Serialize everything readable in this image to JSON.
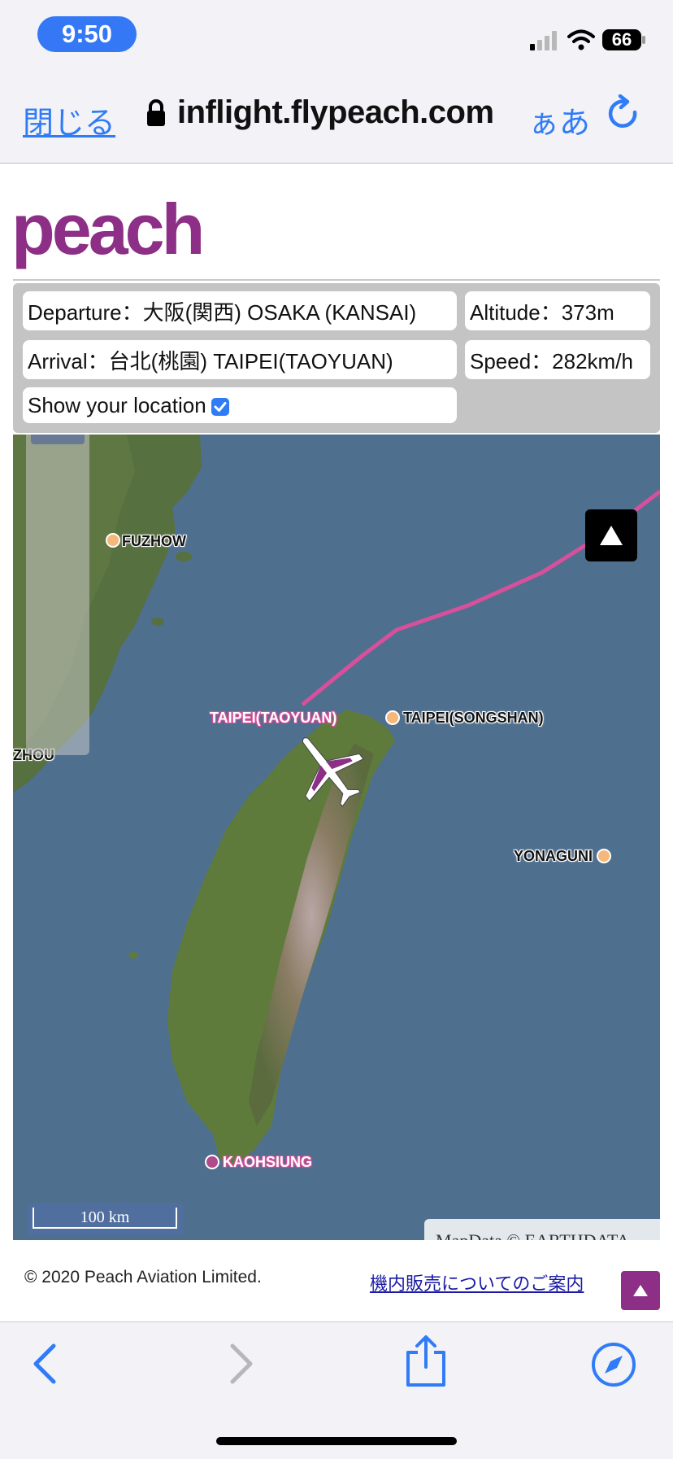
{
  "status_bar": {
    "time": "9:50",
    "battery": "66"
  },
  "address_bar": {
    "close_label": "閉じる",
    "url": "inflight.flypeach.com",
    "text_size_label": "ぁあ"
  },
  "logo_text": "peach",
  "flight_info": {
    "departure": "Departure：大阪(関西) OSAKA (KANSAI)",
    "arrival": "Arrival：台北(桃園) TAIPEI(TAOYUAN)",
    "altitude": "Altitude：373m",
    "speed": "Speed：282km/h",
    "show_location_label": "Show your location",
    "show_location_checked": true
  },
  "map": {
    "labels": {
      "fuzhow": "FUZHOW",
      "taipei_taoyuan": "TAIPEI(TAOYUAN)",
      "taipei_songshan": "TAIPEI(SONGSHAN)",
      "zhou": "ZHOU",
      "yonaguni": "YONAGUNI",
      "kaohsiung": "KAOHSIUNG"
    },
    "scale": "100 km",
    "attribution": "MapData © EARTHDATA",
    "colors": {
      "route": "#d7509b",
      "sea": "#4f6f8f"
    }
  },
  "footer": {
    "copyright": "© 2020 Peach Aviation Limited.",
    "inflight_sales_link": "機内販売についてのご案内"
  },
  "colors": {
    "brand": "#8d2f86",
    "ios_blue": "#2f7cf6"
  }
}
